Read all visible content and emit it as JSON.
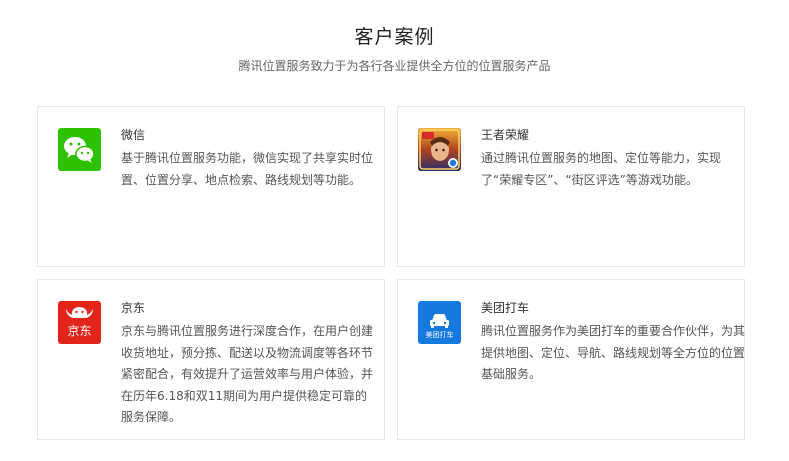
{
  "header": {
    "title": "客户案例",
    "subtitle": "腾讯位置服务致力于为各行各业提供全方位的位置服务产品"
  },
  "cases": [
    {
      "name": "微信",
      "description": "基于腾讯位置服务功能，微信实现了共享实时位置、位置分享、地点检索、路线规划等功能。",
      "logo_icon": "wechat-logo",
      "color": "#2dc100"
    },
    {
      "name": "王者荣耀",
      "description": "通过腾讯位置服务的地图、定位等能力，实现了“荣耀专区”、“街区评选”等游戏功能。",
      "logo_icon": "honor-of-kings-logo",
      "color": "#2a3a7a"
    },
    {
      "name": "京东",
      "description": "京东与腾讯位置服务进行深度合作，在用户创建收货地址，预分拣、配送以及物流调度等各环节紧密配合，有效提升了运营效率与用户体验，并在历年6.18和双11期间为用户提供稳定可靠的服务保障。",
      "logo_icon": "jd-logo",
      "logo_text": "京东",
      "color": "#e1251b"
    },
    {
      "name": "美团打车",
      "description": "腾讯位置服务作为美团打车的重要合作伙伴，为其提供地图、定位、导航、路线规划等全方位的位置基础服务。",
      "logo_icon": "meituan-taxi-logo",
      "logo_text": "美团打车",
      "color": "#1579df"
    }
  ]
}
